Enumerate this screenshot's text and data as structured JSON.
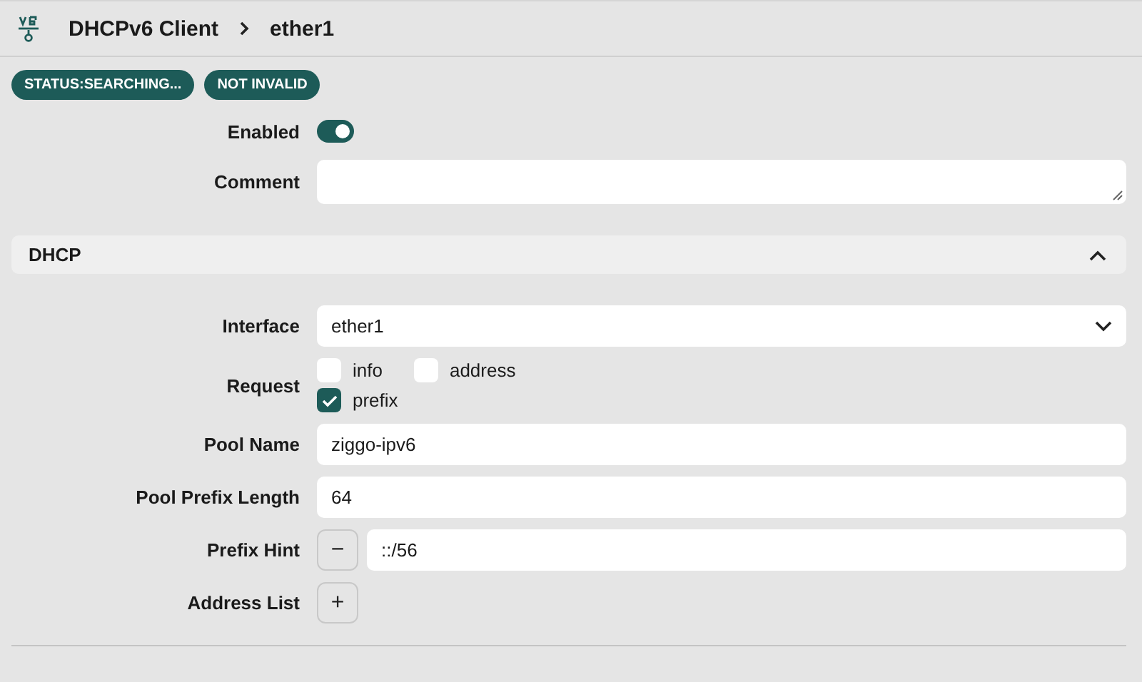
{
  "header": {
    "title": "DHCPv6 Client",
    "crumb": "ether1"
  },
  "badges": [
    "STATUS:SEARCHING...",
    "NOT INVALID"
  ],
  "top_fields": [
    {
      "kind": "toggle",
      "label": "Enabled",
      "on": true
    },
    {
      "kind": "textarea",
      "label": "Comment"
    }
  ],
  "section": {
    "title": "DHCP",
    "expanded": true
  },
  "fields": [
    {
      "kind": "select",
      "label": "Interface",
      "value": "ether1"
    },
    {
      "kind": "checkboxes",
      "label": "Request",
      "options": [
        {
          "label": "info",
          "checked": false
        },
        {
          "label": "address",
          "checked": false
        },
        {
          "label": "prefix",
          "checked": true
        }
      ]
    },
    {
      "kind": "text",
      "label": "Pool Name",
      "value": "ziggo-ipv6"
    },
    {
      "kind": "text",
      "label": "Pool Prefix Length",
      "value": "64"
    },
    {
      "kind": "list",
      "label": "Prefix Hint",
      "button": "−",
      "value": "::/56"
    },
    {
      "kind": "add",
      "label": "Address List",
      "button": "+"
    }
  ]
}
